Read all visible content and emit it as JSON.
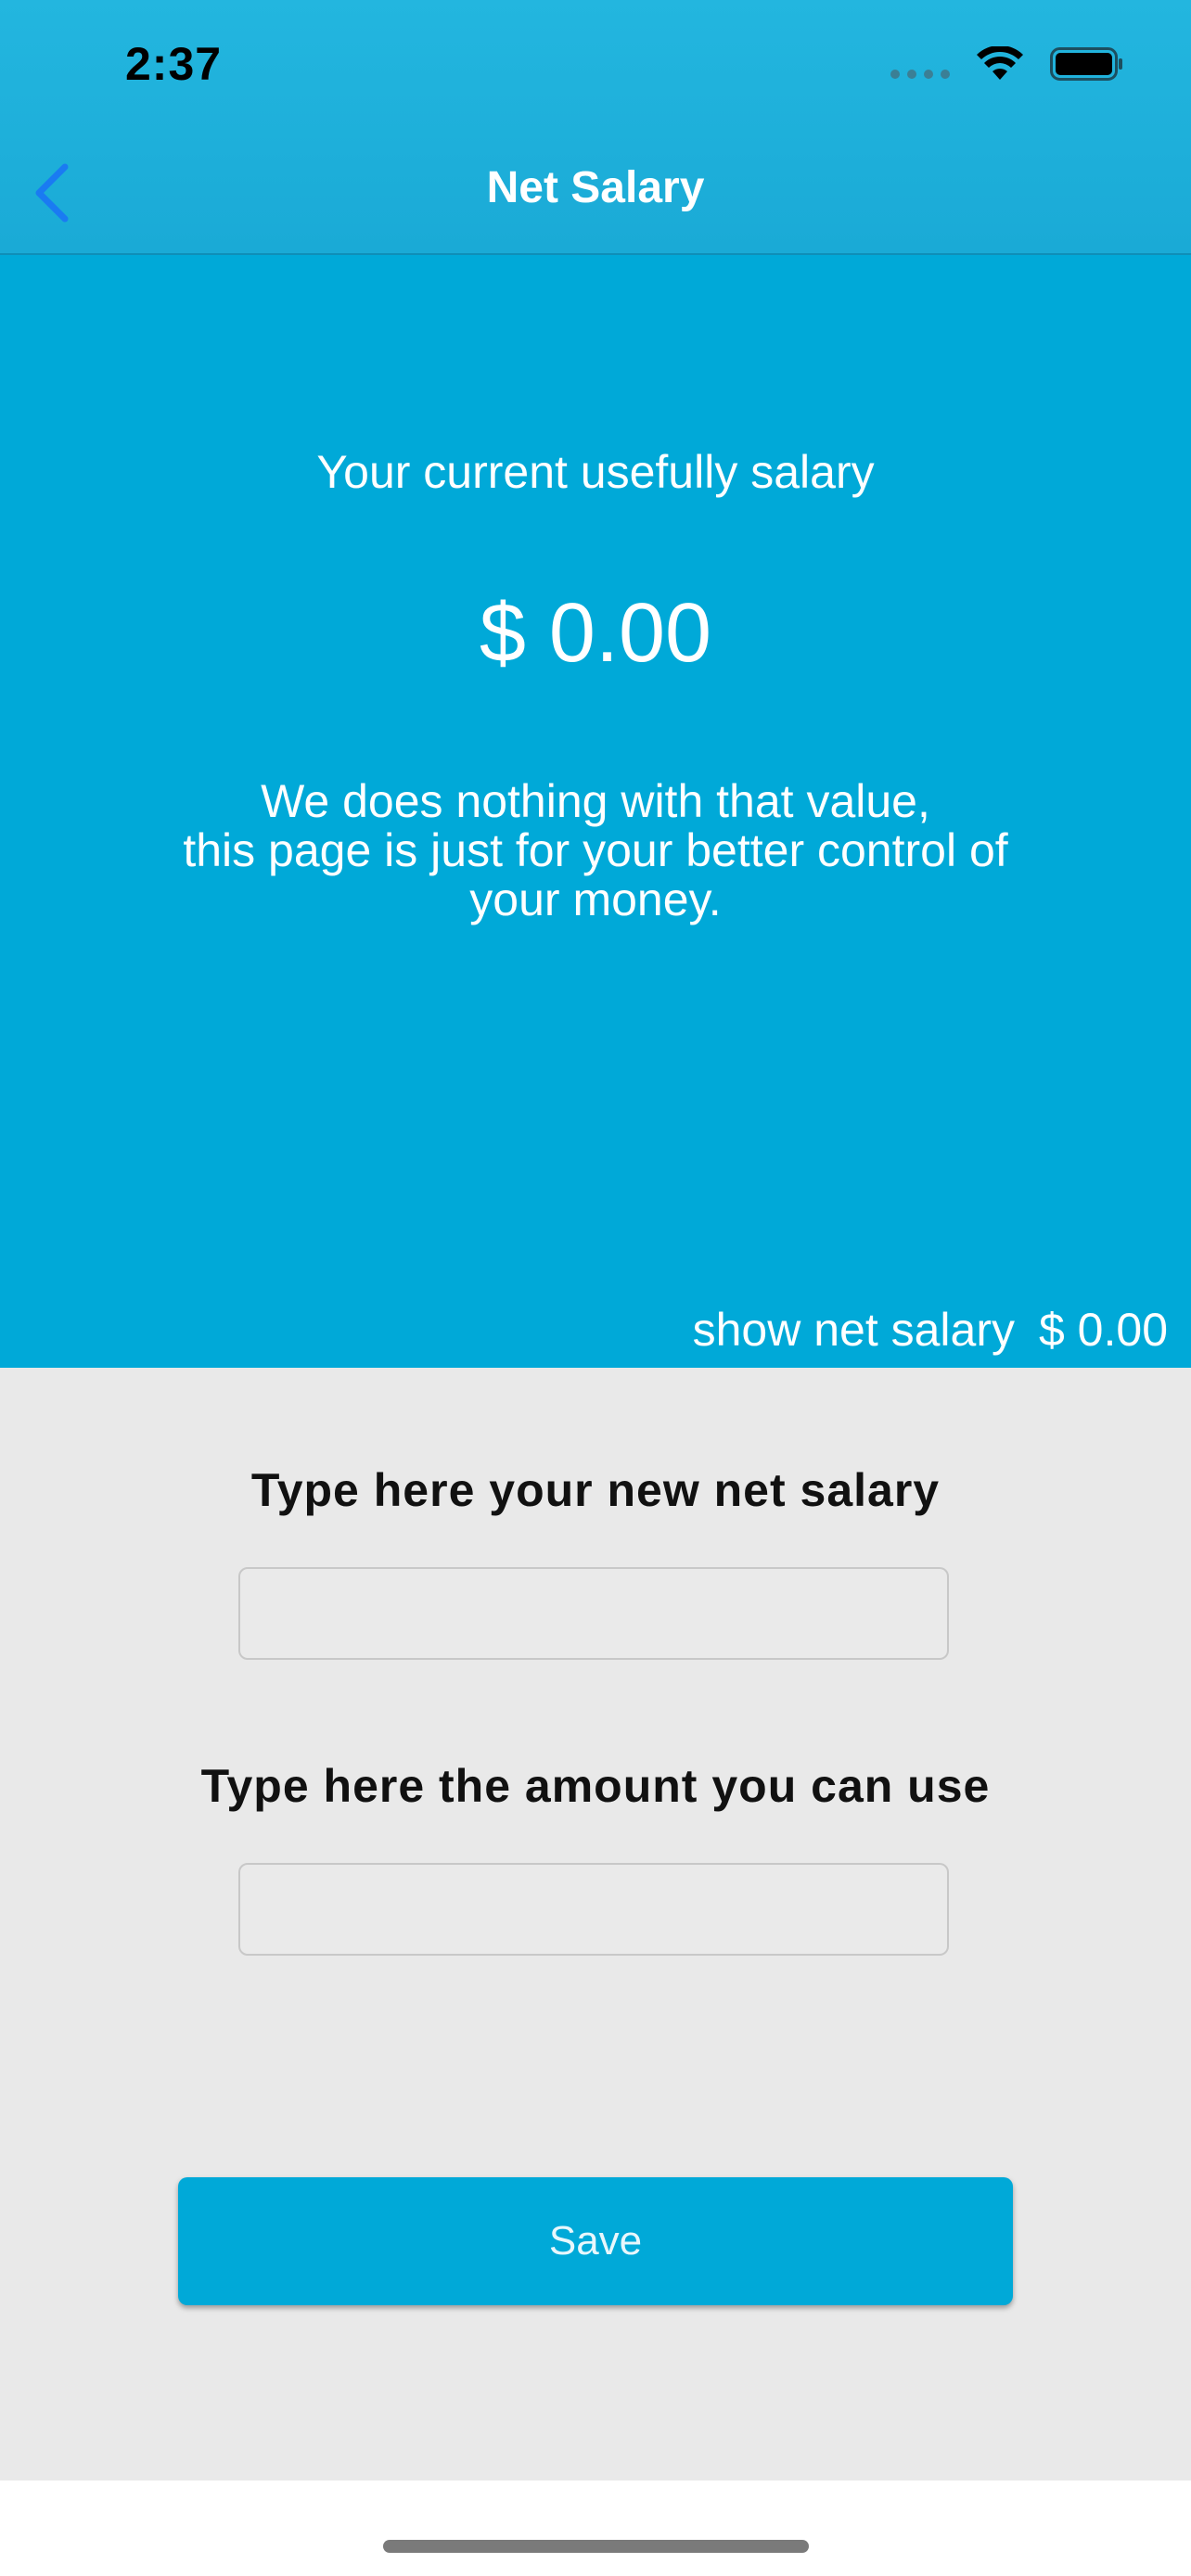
{
  "status_bar": {
    "time": "2:37"
  },
  "nav": {
    "title": "Net Salary"
  },
  "summary": {
    "caption": "Your current usefully salary",
    "amount": "$ 0.00",
    "note_line1": "We  does nothing with that value,",
    "note_line2": "this page is just for your better control of",
    "note_line3": "your money.",
    "net_salary_label": "show net salary",
    "net_salary_value": "$ 0.00"
  },
  "form": {
    "net_salary_label": "Type here your new net salary",
    "net_salary_value": "",
    "usable_amount_label": "Type here the amount you can use",
    "usable_amount_value": "",
    "save_label": "Save"
  },
  "colors": {
    "accent": "#00a9d8",
    "header": "#1aaad6",
    "back_icon": "#1a7bf2",
    "form_background": "#e9e9e9"
  },
  "icons": [
    "chevron-left-icon",
    "cellular-signal-icon",
    "wifi-icon",
    "battery-icon"
  ]
}
